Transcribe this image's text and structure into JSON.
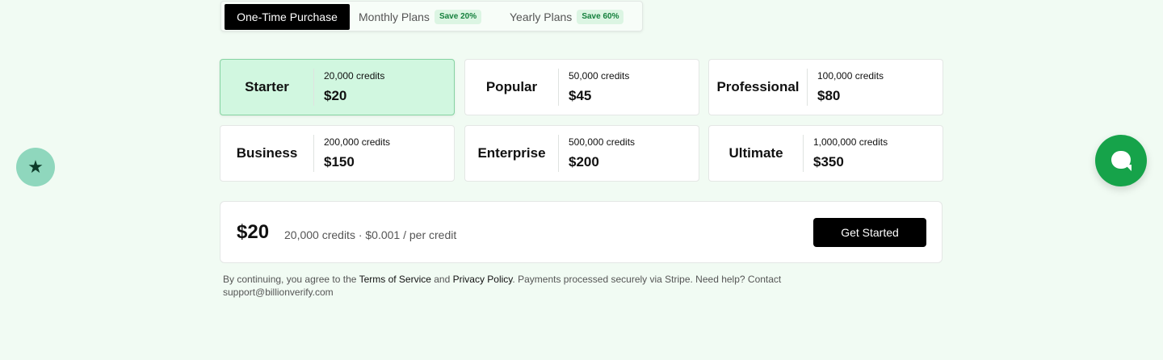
{
  "tabs": {
    "one_time": "One-Time Purchase",
    "monthly": "Monthly Plans",
    "monthly_badge": "Save 20%",
    "yearly": "Yearly Plans",
    "yearly_badge": "Save 60%"
  },
  "plans": [
    {
      "name": "Starter",
      "credits": "20,000 credits",
      "price": "$20",
      "selected": true
    },
    {
      "name": "Popular",
      "credits": "50,000 credits",
      "price": "$45",
      "selected": false
    },
    {
      "name": "Professional",
      "credits": "100,000 credits",
      "price": "$80",
      "selected": false
    },
    {
      "name": "Business",
      "credits": "200,000 credits",
      "price": "$150",
      "selected": false
    },
    {
      "name": "Enterprise",
      "credits": "500,000 credits",
      "price": "$200",
      "selected": false
    },
    {
      "name": "Ultimate",
      "credits": "1,000,000 credits",
      "price": "$350",
      "selected": false
    }
  ],
  "summary": {
    "total": "$20",
    "detail": "20,000 credits · $0.001 / per credit",
    "cta": "Get Started"
  },
  "legal": {
    "prefix": "By continuing, you agree to the ",
    "terms": "Terms of Service",
    "and": " and ",
    "privacy": "Privacy Policy",
    "suffix": ". Payments processed securely via Stripe. Need help? Contact support@billionverify.com"
  },
  "icons": {
    "left_fab": "star-icon",
    "right_fab": "chat-icon"
  },
  "colors": {
    "accent": "#16a34a",
    "selected_card": "#d1f7e0",
    "badge_text": "#15803d"
  }
}
